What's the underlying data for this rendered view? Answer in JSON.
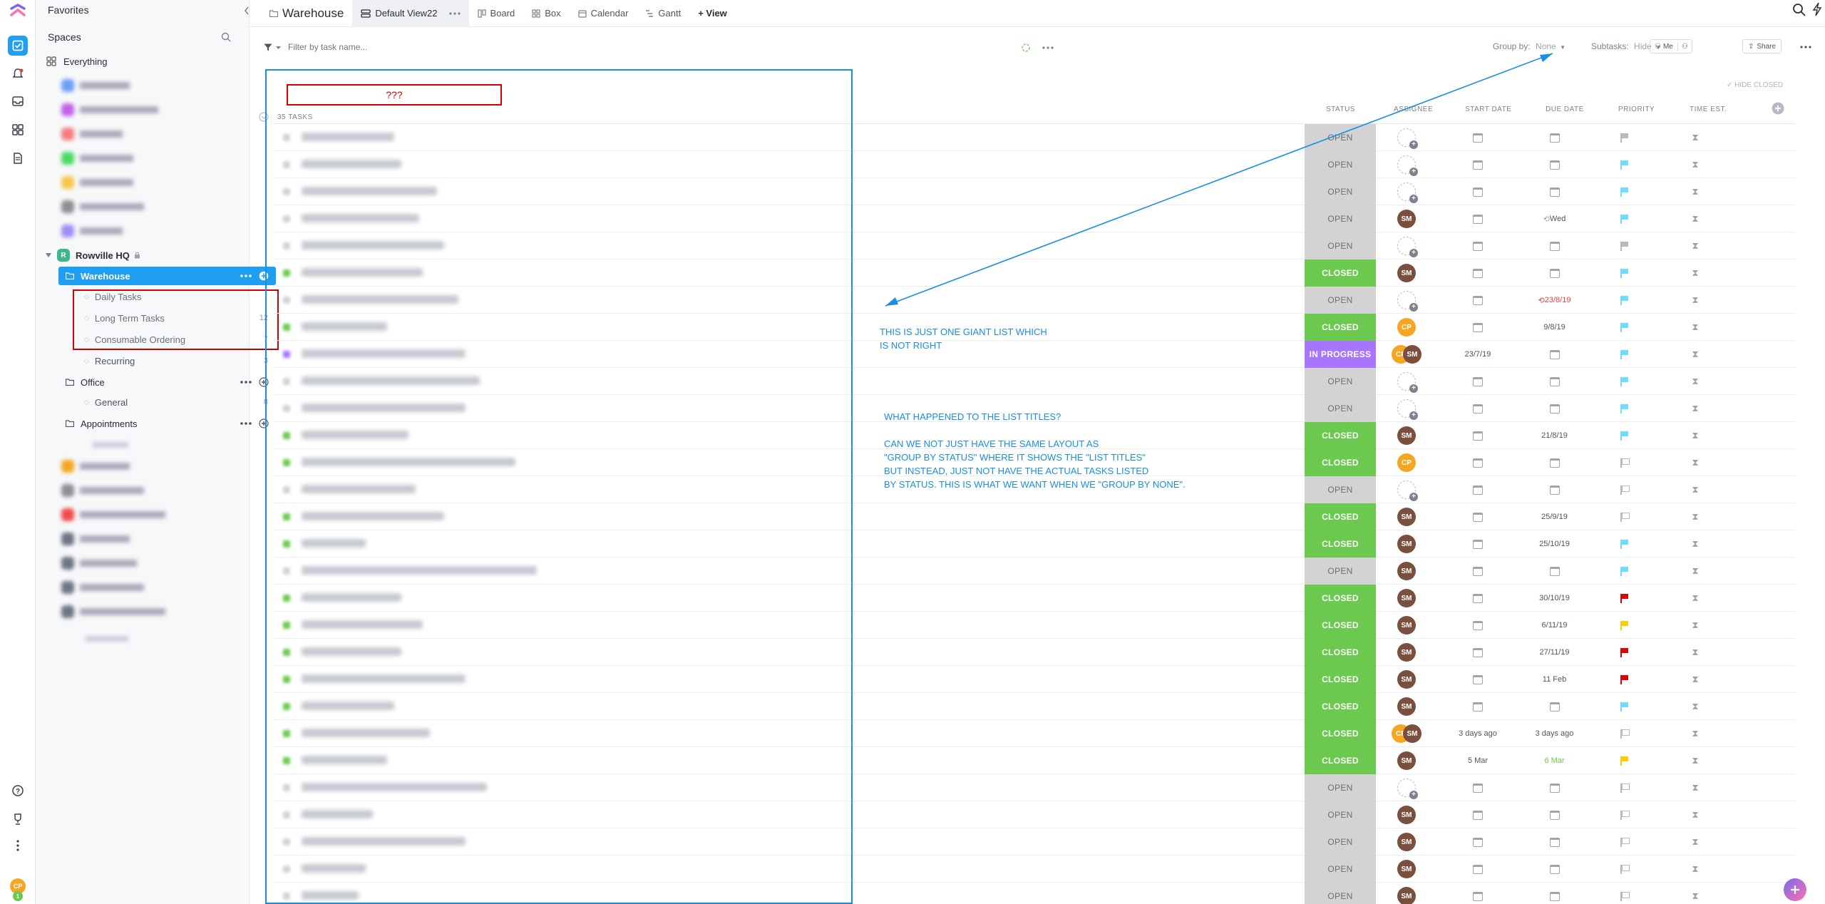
{
  "sidebar": {
    "favorites": "Favorites",
    "spaces": "Spaces",
    "everything": "Everything",
    "space_name": "Rowville HQ",
    "space_initial": "R",
    "folder_warehouse": "Warehouse",
    "lists": [
      {
        "label": "Daily Tasks",
        "count": ""
      },
      {
        "label": "Long Term Tasks",
        "count": "12"
      },
      {
        "label": "Consumable Ordering",
        "count": "7"
      },
      {
        "label": "Recurring",
        "count": "3"
      }
    ],
    "folder_office": "Office",
    "office_lists": [
      {
        "label": "General",
        "count": "8"
      }
    ],
    "folder_appointments": "Appointments",
    "user_initials": "CP",
    "user_badge": "1"
  },
  "tabs": {
    "location": "Warehouse",
    "view_active": "Default View22",
    "board": "Board",
    "box": "Box",
    "calendar": "Calendar",
    "gantt": "Gantt",
    "add_view": "+ View"
  },
  "filter": {
    "placeholder": "Filter by task name...",
    "group_by_label": "Group by:",
    "group_by_value": "None",
    "subtasks_label": "Subtasks:",
    "subtasks_value": "Hide",
    "me": "Me",
    "share": "Share",
    "hide_closed": "HIDE CLOSED"
  },
  "table": {
    "list_title": "???",
    "task_count": "35 TASKS",
    "headers": {
      "status": "STATUS",
      "assignee": "ASSIGNEE",
      "start": "START DATE",
      "due": "DUE DATE",
      "priority": "PRIORITY",
      "time": "TIME EST."
    },
    "rows": [
      {
        "status": "OPEN",
        "assignee": [],
        "start": "",
        "due": "",
        "due_color": "",
        "priority": "gray",
        "name_w": 130
      },
      {
        "status": "OPEN",
        "assignee": [],
        "start": "",
        "due": "",
        "due_color": "",
        "priority": "blue",
        "name_w": 140
      },
      {
        "status": "OPEN",
        "assignee": [],
        "start": "",
        "due": "",
        "due_color": "",
        "priority": "blue",
        "name_w": 190
      },
      {
        "status": "OPEN",
        "assignee": [
          "SM"
        ],
        "start": "",
        "due": "Wed",
        "due_color": "",
        "priority": "blue",
        "name_w": 165
      },
      {
        "status": "OPEN",
        "assignee": [],
        "start": "",
        "due": "",
        "due_color": "",
        "priority": "gray",
        "name_w": 200
      },
      {
        "status": "CLOSED",
        "assignee": [
          "SM"
        ],
        "start": "",
        "due": "",
        "due_color": "",
        "priority": "blue",
        "name_w": 170
      },
      {
        "status": "OPEN",
        "assignee": [],
        "start": "",
        "due": "23/8/19",
        "due_color": "red",
        "priority": "blue",
        "name_w": 220
      },
      {
        "status": "CLOSED",
        "assignee": [
          "CP"
        ],
        "start": "",
        "due": "9/8/19",
        "due_color": "",
        "priority": "blue",
        "name_w": 120
      },
      {
        "status": "IN PROGRESS",
        "assignee": [
          "CP",
          "SM"
        ],
        "start": "23/7/19",
        "due": "",
        "due_color": "",
        "priority": "blue",
        "name_w": 230
      },
      {
        "status": "OPEN",
        "assignee": [],
        "start": "",
        "due": "",
        "due_color": "",
        "priority": "blue",
        "name_w": 250
      },
      {
        "status": "OPEN",
        "assignee": [],
        "start": "",
        "due": "",
        "due_color": "",
        "priority": "blue",
        "name_w": 230
      },
      {
        "status": "CLOSED",
        "assignee": [
          "SM"
        ],
        "start": "",
        "due": "21/8/19",
        "due_color": "",
        "priority": "blue",
        "name_w": 150
      },
      {
        "status": "CLOSED",
        "assignee": [
          "CP"
        ],
        "start": "",
        "due": "",
        "due_color": "",
        "priority": "grayout",
        "name_w": 300
      },
      {
        "status": "OPEN",
        "assignee": [],
        "start": "",
        "due": "",
        "due_color": "",
        "priority": "grayout",
        "name_w": 160
      },
      {
        "status": "CLOSED",
        "assignee": [
          "SM"
        ],
        "start": "",
        "due": "25/9/19",
        "due_color": "",
        "priority": "grayout",
        "name_w": 200
      },
      {
        "status": "CLOSED",
        "assignee": [
          "SM"
        ],
        "start": "",
        "due": "25/10/19",
        "due_color": "",
        "priority": "blue",
        "name_w": 90
      },
      {
        "status": "OPEN",
        "assignee": [
          "SM"
        ],
        "start": "",
        "due": "",
        "due_color": "",
        "priority": "blue",
        "name_w": 330
      },
      {
        "status": "CLOSED",
        "assignee": [
          "SM"
        ],
        "start": "",
        "due": "30/10/19",
        "due_color": "",
        "priority": "red",
        "name_w": 140
      },
      {
        "status": "CLOSED",
        "assignee": [
          "SM"
        ],
        "start": "",
        "due": "6/11/19",
        "due_color": "",
        "priority": "yellow",
        "name_w": 170
      },
      {
        "status": "CLOSED",
        "assignee": [
          "SM"
        ],
        "start": "",
        "due": "27/11/19",
        "due_color": "",
        "priority": "red",
        "name_w": 140
      },
      {
        "status": "CLOSED",
        "assignee": [
          "SM"
        ],
        "start": "",
        "due": "11 Feb",
        "due_color": "",
        "priority": "red",
        "name_w": 230
      },
      {
        "status": "CLOSED",
        "assignee": [
          "SM"
        ],
        "start": "",
        "due": "",
        "due_color": "",
        "priority": "blue",
        "name_w": 130
      },
      {
        "status": "CLOSED",
        "assignee": [
          "CP",
          "SM"
        ],
        "start": "3 days ago",
        "due": "3 days ago",
        "due_color": "",
        "priority": "grayout",
        "name_w": 180
      },
      {
        "status": "CLOSED",
        "assignee": [
          "SM"
        ],
        "start": "5 Mar",
        "due": "6 Mar",
        "due_color": "green",
        "priority": "yellow",
        "name_w": 120
      },
      {
        "status": "OPEN",
        "assignee": [],
        "start": "",
        "due": "",
        "due_color": "",
        "priority": "grayout",
        "name_w": 260
      },
      {
        "status": "OPEN",
        "assignee": [
          "SM"
        ],
        "start": "",
        "due": "",
        "due_color": "",
        "priority": "grayout",
        "name_w": 100
      },
      {
        "status": "OPEN",
        "assignee": [
          "SM"
        ],
        "start": "",
        "due": "",
        "due_color": "",
        "priority": "grayout",
        "name_w": 230
      },
      {
        "status": "OPEN",
        "assignee": [
          "SM"
        ],
        "start": "",
        "due": "",
        "due_color": "",
        "priority": "grayout",
        "name_w": 90
      },
      {
        "status": "OPEN",
        "assignee": [
          "SM"
        ],
        "start": "",
        "due": "",
        "due_color": "",
        "priority": "grayout",
        "name_w": 80
      }
    ]
  },
  "annotations": {
    "note1": [
      "THIS IS JUST ONE GIANT LIST WHICH",
      "IS NOT RIGHT"
    ],
    "note2": [
      "WHAT HAPPENED TO THE LIST TITLES?",
      "",
      "CAN WE NOT JUST HAVE THE SAME LAYOUT AS",
      "\"GROUP BY STATUS\" WHERE IT SHOWS THE \"LIST TITLES\"",
      "BUT INSTEAD, JUST NOT HAVE THE ACTUAL TASKS LISTED",
      "BY STATUS. THIS IS WHAT WE WANT WHEN WE \"GROUP BY NONE\"."
    ]
  },
  "colors": {
    "accent": "#1e9ff2",
    "closed": "#6bc950",
    "open": "#d3d3d3",
    "in_progress": "#a875ff",
    "annotation": "#1a8ee0",
    "annotation_box": "#d00000"
  }
}
